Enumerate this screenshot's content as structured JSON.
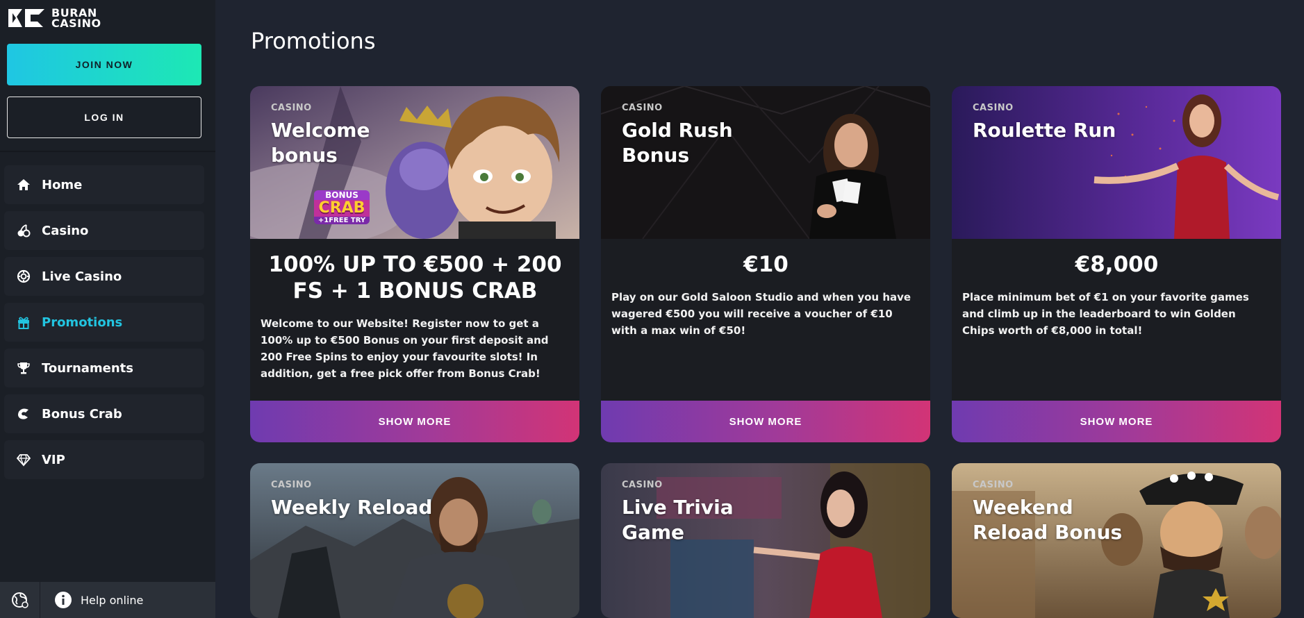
{
  "brand": {
    "line1": "BURAN",
    "line2": "CASINO"
  },
  "auth": {
    "join_label": "JOIN NOW",
    "login_label": "LOG IN"
  },
  "nav": [
    {
      "label": "Home",
      "icon": "home-icon",
      "active": false
    },
    {
      "label": "Casino",
      "icon": "cherries-icon",
      "active": false
    },
    {
      "label": "Live Casino",
      "icon": "chip-icon",
      "active": false
    },
    {
      "label": "Promotions",
      "icon": "gift-icon",
      "active": true
    },
    {
      "label": "Tournaments",
      "icon": "trophy-icon",
      "active": false
    },
    {
      "label": "Bonus Crab",
      "icon": "crab-claw-icon",
      "active": false
    },
    {
      "label": "VIP",
      "icon": "diamond-icon",
      "active": false
    }
  ],
  "footer": {
    "help_label": "Help online"
  },
  "page": {
    "title": "Promotions"
  },
  "promotions": [
    {
      "category": "CASINO",
      "title": "Welcome bonus",
      "amount": "100% UP TO €500 + 200 FS + 1 BONUS CRAB",
      "description": "Welcome to our Website! Register now to get a 100% up to €500 Bonus on your first deposit and 200 Free Spins to enjoy your favourite slots! In addition, get a free pick offer from Bonus Crab!",
      "button": "SHOW MORE",
      "badge_line1": "BONUS",
      "badge_line2": "CRAB",
      "badge_line3": "+1FREE TRY"
    },
    {
      "category": "CASINO",
      "title": "Gold Rush Bonus",
      "amount": "€10",
      "description": "Play on our Gold Saloon Studio and when you have wagered €500 you will receive a voucher of €10 with a max win of €50!",
      "button": "SHOW MORE"
    },
    {
      "category": "CASINO",
      "title": "Roulette Run",
      "amount": "€8,000",
      "description": "Place minimum bet of €1 on your favorite games and climb up in the leaderboard to win Golden Chips worth of €8,000 in total!",
      "button": "SHOW MORE"
    },
    {
      "category": "CASINO",
      "title": "Weekly Reload"
    },
    {
      "category": "CASINO",
      "title": "Live Trivia Game"
    },
    {
      "category": "CASINO",
      "title": "Weekend Reload Bonus"
    }
  ],
  "colors": {
    "accent": "#22c4e0",
    "join_from": "#1fc6e3",
    "join_to": "#1de8b4",
    "button_from": "#6f3bb0",
    "button_to": "#d23476"
  }
}
